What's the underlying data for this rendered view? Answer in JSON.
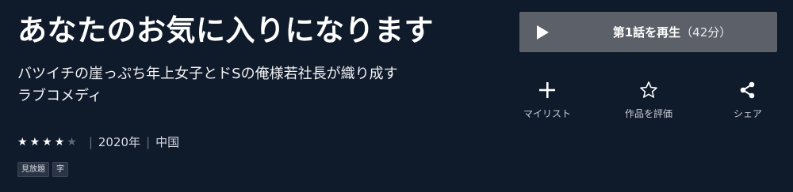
{
  "title": "あなたのお気に入りになります",
  "description": {
    "line1": "バツイチの崖っぷち年上女子とドSの俺様若社長が織り成す",
    "line2": "ラブコメディ"
  },
  "rating": {
    "filled": 4,
    "total": 5
  },
  "meta": {
    "year": "2020年",
    "country": "中国"
  },
  "badges": {
    "unlimited": "見放題",
    "subtitles": "字"
  },
  "play": {
    "label": "第1話を再生",
    "duration": "（42分）"
  },
  "actions": {
    "mylist": "マイリスト",
    "rate": "作品を評価",
    "share": "シェア"
  },
  "colors": {
    "background": "#0f1a2b",
    "play_button": "#5c6068",
    "star_on": "#ffffff",
    "star_off": "#5f6776"
  }
}
